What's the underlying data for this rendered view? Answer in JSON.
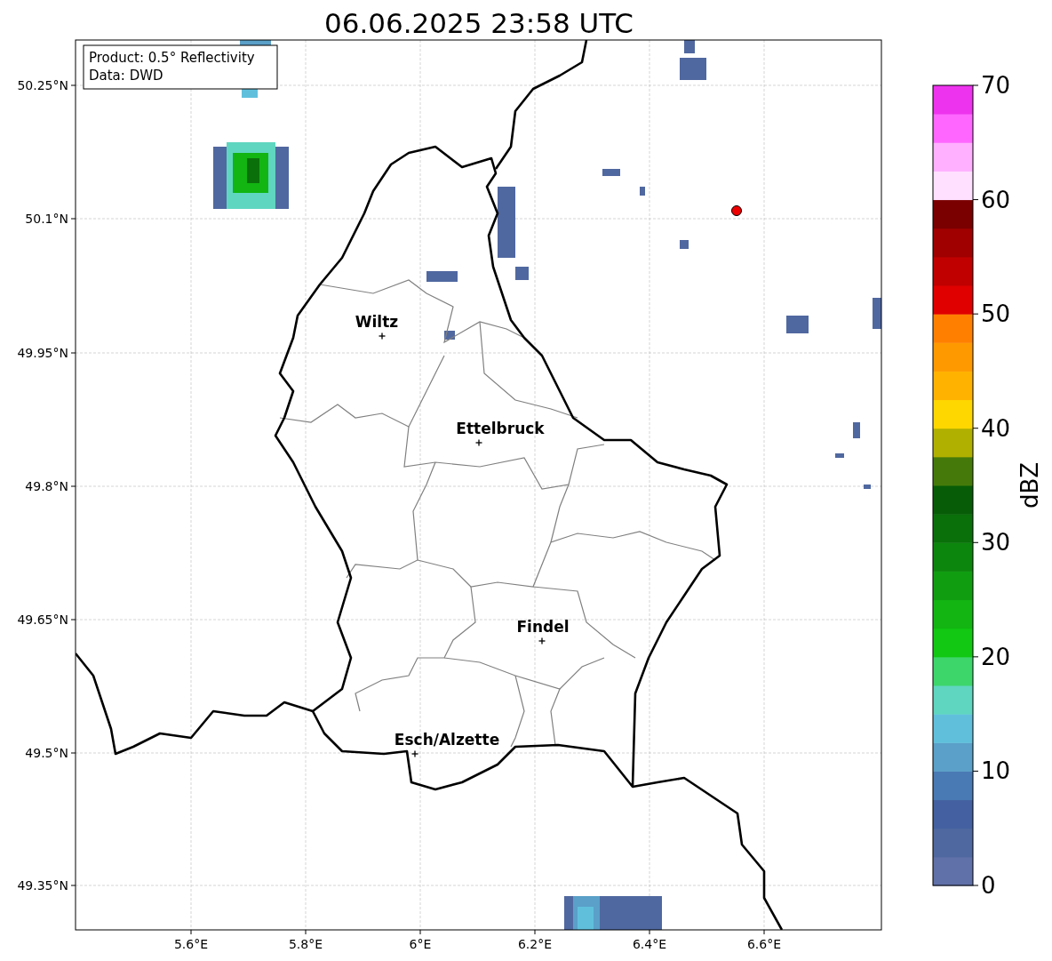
{
  "title": "06.06.2025 23:58 UTC",
  "info_box": [
    "Product: 0.5° Reflectivity",
    "Data: DWD"
  ],
  "lat_labels": [
    "50.25°N",
    "50.1°N",
    "49.95°N",
    "49.8°N",
    "49.65°N",
    "49.5°N",
    "49.35°N"
  ],
  "lon_labels": [
    "5.6°E",
    "5.8°E",
    "6°E",
    "6.2°E",
    "6.4°E",
    "6.6°E"
  ],
  "cities": [
    {
      "name": "Wiltz"
    },
    {
      "name": "Ettelbruck"
    },
    {
      "name": "Findel"
    },
    {
      "name": "Esch/Alzette"
    }
  ],
  "colorbar": {
    "label": "dBZ",
    "ticks": [
      "70",
      "60",
      "50",
      "40",
      "30",
      "20",
      "10",
      "0"
    ],
    "bands": [
      {
        "color": "#6070a8"
      },
      {
        "color": "#5068a0"
      },
      {
        "color": "#4460a0"
      },
      {
        "color": "#4a7ab4"
      },
      {
        "color": "#5aa0c8"
      },
      {
        "color": "#60c0dc"
      },
      {
        "color": "#5fd6c0"
      },
      {
        "color": "#3dd66b"
      },
      {
        "color": "#12c812"
      },
      {
        "color": "#12b512"
      },
      {
        "color": "#109e10"
      },
      {
        "color": "#0c860c"
      },
      {
        "color": "#0a700a"
      },
      {
        "color": "#075c07"
      },
      {
        "color": "#457a0a"
      },
      {
        "color": "#b0b000"
      },
      {
        "color": "#ffd700"
      },
      {
        "color": "#ffb300"
      },
      {
        "color": "#ff9900"
      },
      {
        "color": "#ff8000"
      },
      {
        "color": "#e00000"
      },
      {
        "color": "#c00000"
      },
      {
        "color": "#a00000"
      },
      {
        "color": "#7a0000"
      },
      {
        "color": "#ffe0ff"
      },
      {
        "color": "#ffb0ff"
      },
      {
        "color": "#ff66ff"
      },
      {
        "color": "#ee33ee"
      }
    ]
  }
}
